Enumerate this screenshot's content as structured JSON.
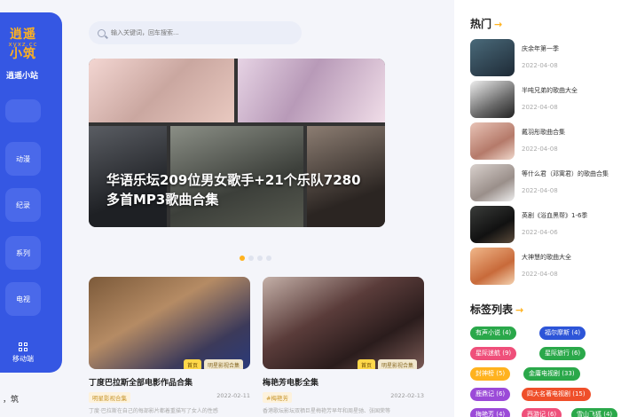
{
  "sidebar": {
    "logo_line1": "逍遥",
    "logo_line2": "xyxz.cc",
    "logo_line3": "小筑",
    "site_name": "逍遥小站",
    "items": [
      {
        "label": ""
      },
      {
        "label": "动漫"
      },
      {
        "label": "纪录"
      },
      {
        "label": "系列"
      },
      {
        "label": "电视"
      }
    ],
    "bottom_item": {
      "label": "移动端",
      "icon": "grid-icon"
    }
  },
  "page_edge_text": "，筑",
  "search": {
    "placeholder": "输入关键词，回车搜索..."
  },
  "hero": {
    "title": "华语乐坛209位男女歌手+21个乐队7280多首MP3歌曲合集",
    "slides": 4,
    "active_slide": 0
  },
  "cards": [
    {
      "title": "丁度巴拉斯全部电影作品合集",
      "tags": [
        "首页",
        "明星影视合集"
      ],
      "category": "明星影视合集",
      "date": "2022-02-11",
      "desc": "丁度·巴拉斯在自己的每部影片都着重描写了女人的性感"
    },
    {
      "title": "梅艳芳电影全集",
      "tags": [
        "首页",
        "明星影视合集"
      ],
      "category": "#梅艳芳",
      "date": "2022-02-13",
      "desc": "香港歌坛影坛双栖巨星梅艳芳早年和周星驰、张国荣等"
    }
  ],
  "hot": {
    "title": "热门",
    "items": [
      {
        "name": "庆余年第一季",
        "date": "2022-04-08"
      },
      {
        "name": "半吨兄弟的歌曲大全",
        "date": "2022-04-08"
      },
      {
        "name": "戴羽彤歌曲合集",
        "date": "2022-04-08"
      },
      {
        "name": "等什么君（邓寓君）的歌曲合集",
        "date": "2022-04-08"
      },
      {
        "name": "英剧《浴血黑帮》1-6季",
        "date": "2022-04-06"
      },
      {
        "name": "大神慧的歌曲大全",
        "date": "2022-04-08"
      }
    ]
  },
  "tags_section": {
    "title": "标签列表",
    "tags": [
      {
        "label": "有声小说 (4)",
        "color": "#2aa84a"
      },
      {
        "label": "福尔摩斯 (4)",
        "color": "#2d55d8"
      },
      {
        "label": "星际迷航 (9)",
        "color": "#ef4f7a"
      },
      {
        "label": "星际旅行 (6)",
        "color": "#2aa84a"
      },
      {
        "label": "封神榜 (5)",
        "color": "#ffb21e"
      },
      {
        "label": "金庸电视剧 (33)",
        "color": "#2aa84a"
      },
      {
        "label": "鹿鼎记 (6)",
        "color": "#9b4ad8"
      },
      {
        "label": "四大名著电视剧 (15)",
        "color": "#ef4f2a"
      },
      {
        "label": "梅艳芳 (4)",
        "color": "#9b4ad8"
      },
      {
        "label": "西游记 (6)",
        "color": "#ef4f7a"
      },
      {
        "label": "雪山飞狐 (4)",
        "color": "#2aa84a"
      }
    ]
  }
}
